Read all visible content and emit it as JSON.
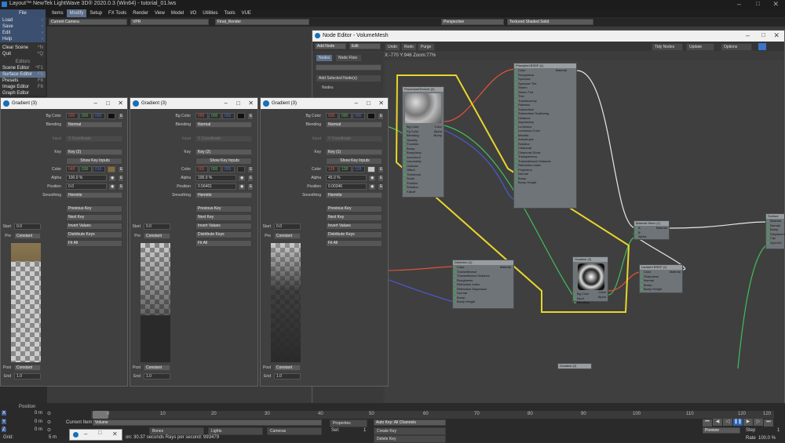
{
  "app": {
    "title": "Layout™ NewTek LightWave 3D® 2020.0.3 (Win64) - tutorial_01.lws"
  },
  "top_tabs": [
    "Items",
    "Modify",
    "Setup",
    "FX Tools",
    "Render",
    "View",
    "Model",
    "I/O",
    "Utilities",
    "Tools",
    "VUE"
  ],
  "file_menu": "File",
  "left_panel": {
    "buttons": [
      {
        "label": "Load",
        "key": ""
      },
      {
        "label": "Save",
        "key": ""
      },
      {
        "label": "Edit",
        "key": ""
      },
      {
        "label": "Help",
        "key": ""
      },
      {
        "label": "Clear Scene",
        "key": "^N"
      },
      {
        "label": "Quit",
        "key": "^Q"
      }
    ],
    "editors_header": "Editors",
    "editors": [
      {
        "label": "Scene Editor",
        "key": "^F1"
      },
      {
        "label": "Surface Editor",
        "key": "F5"
      },
      {
        "label": "Presets",
        "key": "F8"
      },
      {
        "label": "Image Editor",
        "key": "F6"
      },
      {
        "label": "Graph Editor",
        "key": ""
      }
    ]
  },
  "viewport_bar": {
    "camera": "Current Camera",
    "vpr": "VPR",
    "render": "Final_Render",
    "view": "Perspective",
    "shading": "Textured Shaded Solid"
  },
  "node_editor": {
    "title": "Node Editor - VolumeMesh",
    "add_node": "Add Node",
    "edit": "Edit",
    "undo": "Undo",
    "redo": "Redo",
    "purge": "Purge",
    "tidy": "Tidy Nodes",
    "update": "Update",
    "options": "Options",
    "tabs": [
      "Nodes",
      "Node Flow"
    ],
    "coords": "X:-770 Y:946 Zoom:77%",
    "add_selected": "Add Selected Node(s)",
    "nodes_header": "Nodes",
    "nodes": {
      "procedural": {
        "title": "ProceduralTexture (2)",
        "out": [
          "Color",
          "Alpha",
          "Bump"
        ],
        "in": [
          "Bg Color",
          "Fg Color",
          "Blending",
          "Opacity",
          "Function",
          "Bump",
          "BumpAmp",
          "Increment",
          "Lacunarity",
          "Octaves",
          "Offset",
          "Threshold",
          "Scale",
          "Position",
          "Rotation",
          "Falloff"
        ]
      },
      "principled": {
        "title": "Principled BSDF (1)",
        "out": [
          "Material"
        ],
        "in": [
          "Color",
          "Roughness",
          "Specular",
          "Specular Tint",
          "Sheen",
          "Sheen Tint",
          "Thin",
          "Translucency",
          "Flatness",
          "Subsurface",
          "Subsurface Scattering",
          "Distance",
          "Asymmetry",
          "Luminous",
          "Luminous Color",
          "Metallic",
          "Anisotropic",
          "Rotation",
          "Clearcoat",
          "Clearcoat Gloss",
          "Transparency",
          "Transmittance Distance",
          "Refraction Index",
          "Projection",
          "Normal",
          "Bump",
          "Bump Height"
        ]
      },
      "material_mixer": {
        "title": "Material Mixer (1)",
        "out": [
          "Material"
        ],
        "in": [
          "A",
          "B",
          "Alpha"
        ]
      },
      "surface": {
        "title": "Surface",
        "in": [
          "Material",
          "Normal",
          "Bump",
          "Displacement",
          "Clip",
          "OpenGL"
        ]
      },
      "dielectric": {
        "title": "Dielectric (1)",
        "out": [
          "Material"
        ],
        "in": [
          "Color",
          "Transmittance",
          "Transmittance Distance",
          "Roughness",
          "Refraction Index",
          "Refraction Dispersion",
          "Normal",
          "Bump",
          "Bump Height"
        ]
      },
      "gradient": {
        "title": "Gradient (3)",
        "out": [
          "Color",
          "Alpha"
        ],
        "in": [
          "Bg Color",
          "Input",
          "Blending"
        ]
      },
      "lambert": {
        "title": "Lambert BSDF (1)",
        "out": [
          "Material"
        ],
        "in": [
          "Color",
          "Sharpness",
          "Normal",
          "Bump",
          "Bump Height"
        ]
      },
      "gradient2": {
        "title": "Gradient (2)"
      }
    }
  },
  "gradient_windows": [
    {
      "title": "Gradient (3)",
      "bg_color": [
        "000",
        "000",
        "000"
      ],
      "blending": "Normal",
      "input": "Y Coordinate",
      "key": "Key (2)",
      "color": [
        "048",
        "036",
        "016"
      ],
      "alpha": "100.0 %",
      "position": "0.0",
      "smoothing": "Hermite",
      "start": "0.0",
      "pre": "Constant",
      "post": "Constant",
      "end": "1.0"
    },
    {
      "title": "Gradient (3)",
      "bg_color": [
        "000",
        "000",
        "000"
      ],
      "blending": "Normal",
      "input": "Y Coordinate",
      "key": "Key (2)",
      "color": [
        "005",
        "005",
        "005"
      ],
      "alpha": "100.0 %",
      "position": "0.56401",
      "smoothing": "Hermite",
      "start": "0.0",
      "pre": "Constant",
      "post": "Constant",
      "end": "1.0"
    },
    {
      "title": "Gradient (3)",
      "bg_color": [
        "000",
        "000",
        "000"
      ],
      "blending": "Normal",
      "input": "Y Coordinate",
      "key": "Key (1)",
      "color": [
        "128",
        "128",
        "128"
      ],
      "alpha": "45.0 %",
      "position": "0.00346",
      "smoothing": "Hermite",
      "start": "0.0",
      "pre": "Constant",
      "post": "Constant",
      "end": "1.0"
    }
  ],
  "gradient_labels": {
    "bg_color": "Bg Color",
    "blending": "Blending",
    "input": "Input",
    "key": "Key",
    "show_key_inputs": "Show Key Inputs",
    "color": "Color",
    "alpha": "Alpha",
    "position": "Position",
    "smoothing": "Smoothing",
    "previous_key": "Previous Key",
    "next_key": "Next Key",
    "invert_values": "Invert Values",
    "distribute_keys": "Distribute Keys",
    "fit_all": "Fit All",
    "start": "Start",
    "pre": "Pre",
    "post": "Post",
    "end": "End",
    "e": "E"
  },
  "timeline": {
    "position_label": "Position",
    "ticks": [
      "0",
      "10",
      "20",
      "30",
      "40",
      "50",
      "60",
      "70",
      "80",
      "90",
      "100",
      "110",
      "120",
      "120"
    ],
    "axes": [
      {
        "axis": "X",
        "value": "0 m"
      },
      {
        "axis": "Y",
        "value": "0 m"
      },
      {
        "axis": "Z",
        "value": "0 m"
      }
    ],
    "grid_label": "Grid:",
    "grid_value": "5 m",
    "current_item_label": "Current Item",
    "current_item": "Volume",
    "bones": "Bones",
    "lights": "Lights",
    "cameras": "Cameras",
    "properties": "Properties",
    "sel_label": "Sel:",
    "sel_value": "1",
    "auto_key": "Auto Key: All Channels",
    "create_key": "Create Key",
    "delete_key": "Delete Key",
    "status": "on: 30.37 seconds  Rays per second: 993479",
    "preview": "Preview",
    "step_label": "Step",
    "step_value": "1",
    "rate_label": "Rate",
    "rate_value": "100.0 %"
  },
  "colors": {
    "accent": "#e8d62a",
    "tab_active": "#5a6f8a"
  }
}
